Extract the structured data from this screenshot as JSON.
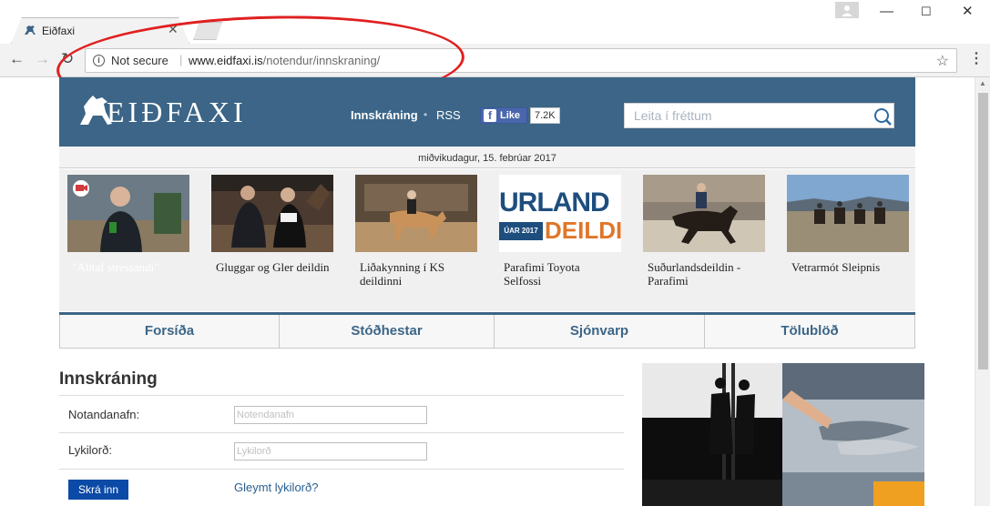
{
  "browser": {
    "tab_title": "Eiðfaxi",
    "security_label": "Not secure",
    "url_host": "www.eidfaxi.is",
    "url_path": "/notendur/innskraning/",
    "icons": [
      "back-arrow-icon",
      "forward-arrow-icon",
      "reload-icon",
      "info-icon",
      "star-icon",
      "menu-icon",
      "close-icon",
      "minimize-icon",
      "maximize-icon",
      "profile-icon"
    ],
    "annotation_color": "#e02020"
  },
  "header": {
    "logo_text": "EIÐFAXI",
    "login_link": "Innskráning",
    "rss_link": "RSS",
    "fb_like": "Like",
    "fb_count": "7.2K",
    "search_placeholder": "Leita í fréttum",
    "brand_color": "#3c6587"
  },
  "date_line": "miðvikudagur, 15. febrúar 2017",
  "news": [
    {
      "title": "\"Alltaf stressandi\"",
      "thumb": "video-interview-photo"
    },
    {
      "title": "Gluggar og Gler deildin",
      "thumb": "riders-in-arena-photo"
    },
    {
      "title": "Liðakynning í KS deildinni",
      "thumb": "horse-rider-photo"
    },
    {
      "title": "Parafimi Toyota Selfossi",
      "thumb": "urland-deildin-banner",
      "banner_text_top": "URLAND",
      "banner_date": "ÚAR 2017",
      "banner_text_bottom": "DEILDI"
    },
    {
      "title": "Suðurlandsdeildin - Parafimi",
      "thumb": "horse-rider-photo-2"
    },
    {
      "title": "Vetrarmót Sleipnis",
      "thumb": "riders-in-field-photo"
    }
  ],
  "nav": [
    "Forsíða",
    "Stóðhestar",
    "Sjónvarp",
    "Tölublöð"
  ],
  "login": {
    "title": "Innskráning",
    "username_label": "Notandanafn:",
    "username_placeholder": "Notendanafn",
    "password_label": "Lykilorð:",
    "password_placeholder": "Lykilorð",
    "submit": "Skrá inn",
    "forgot": "Gleymt lykilorð?"
  }
}
